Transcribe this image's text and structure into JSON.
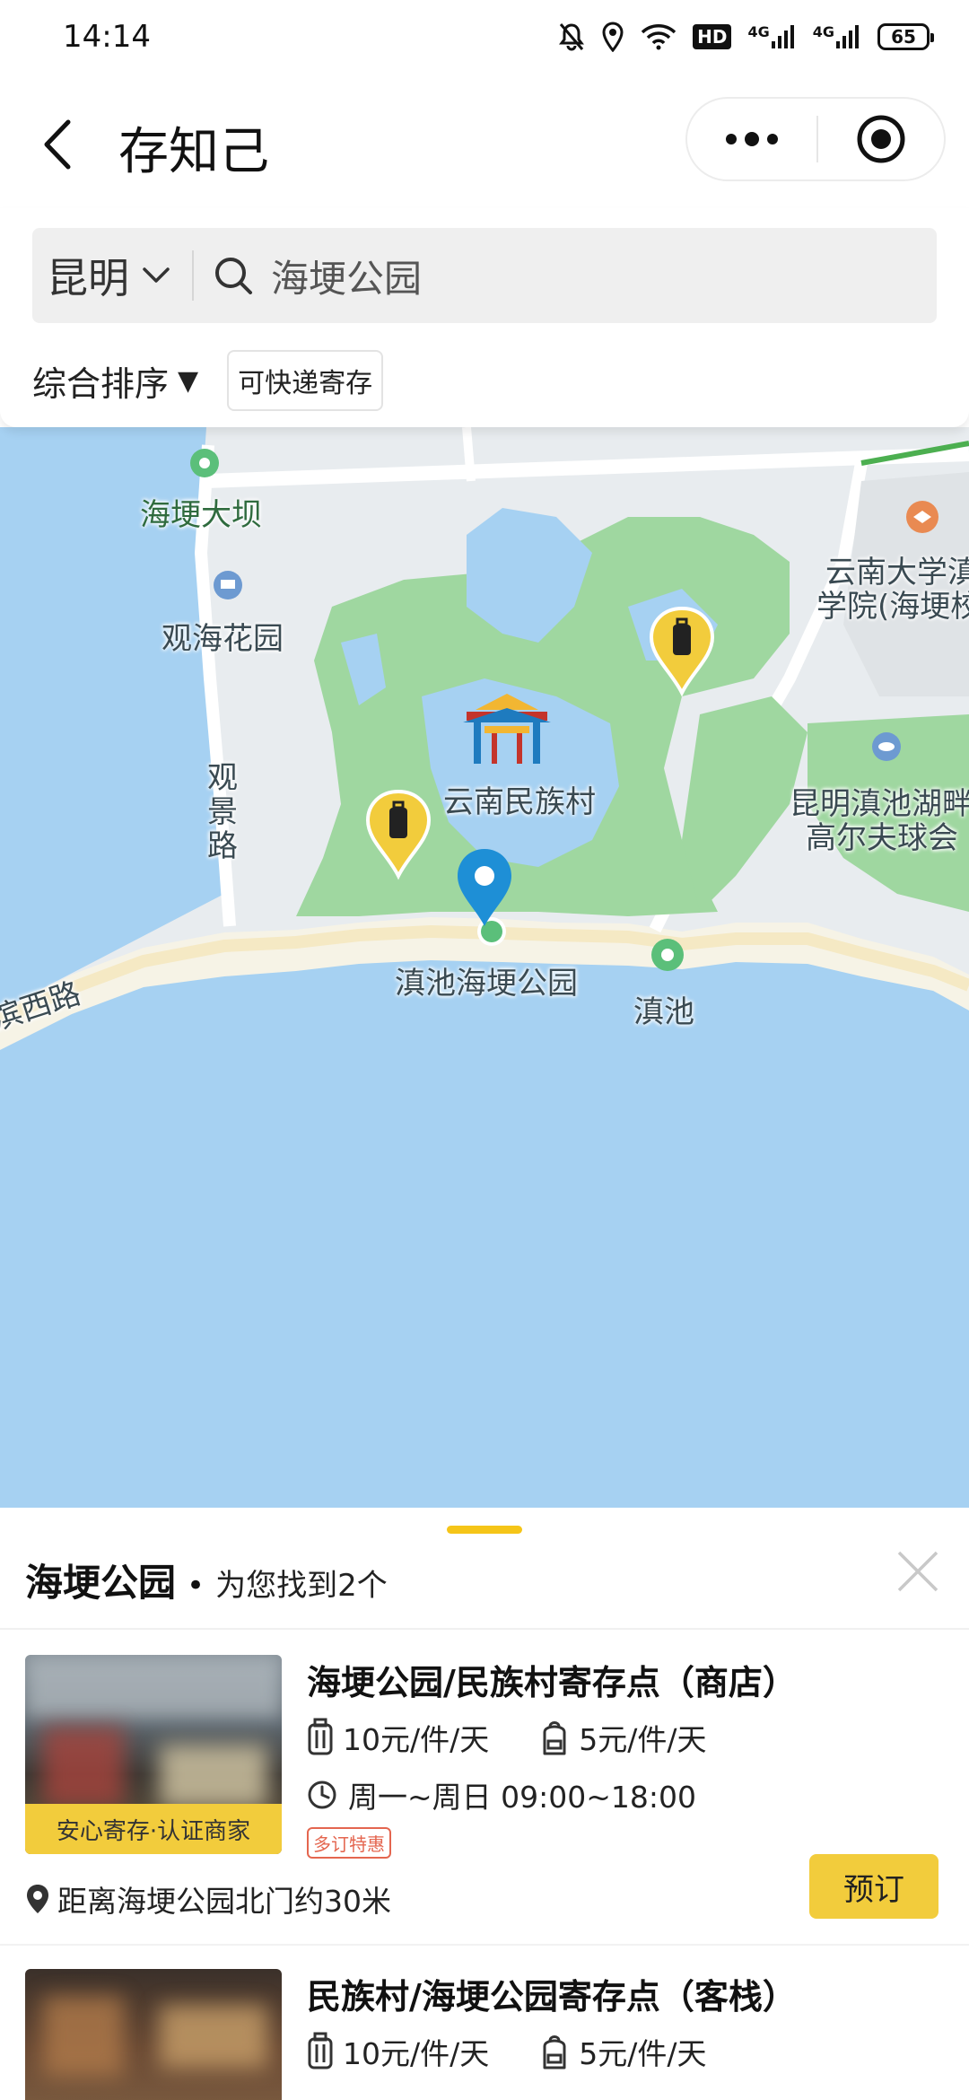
{
  "status_bar": {
    "time": "14:14",
    "hd_label": "HD",
    "net1": "4G",
    "net2": "4G",
    "battery": "65"
  },
  "nav": {
    "title": "存知己"
  },
  "search": {
    "city": "昆明",
    "query": "海埂公园"
  },
  "filters": {
    "sort_label": "综合排序",
    "sort_arrow": "▼",
    "chip_label": "可快递寄存"
  },
  "map": {
    "labels": {
      "haigeng_dam": "海埂大坝",
      "guanhai_garden": "观海花园",
      "guanjing_road": "观景路",
      "yunnan_ethnic_village": "云南民族村",
      "dianchi_haigeng_park": "滇池海埂公园",
      "dianchi": "滇池",
      "binxi_road": "滨西路",
      "yunnan_univ_1": "云南大学滇",
      "yunnan_univ_2": "学院(海埂校",
      "golf_1": "昆明滇池湖畔",
      "golf_2": "高尔夫球会"
    }
  },
  "results": {
    "place": "海埂公园",
    "dot": "•",
    "summary": "为您找到2个",
    "items": [
      {
        "title": "海埂公园/民族村寄存点（商店）",
        "luggage_price": "10元/件/天",
        "bag_price": "5元/件/天",
        "hours": "周一~周日 09:00~18:00",
        "badge": "安心寄存·认证商家",
        "promo": "多订特惠",
        "distance": "距离海埂公园北门约30米",
        "book_label": "预订"
      },
      {
        "title": "民族村/海埂公园寄存点（客栈）",
        "luggage_price": "10元/件/天",
        "bag_price": "5元/件/天"
      }
    ]
  },
  "colors": {
    "accent": "#f2cc3c",
    "map_water": "#a6d1f2",
    "map_park": "#9fd7a0",
    "pin_blue": "#1e8fd6"
  }
}
